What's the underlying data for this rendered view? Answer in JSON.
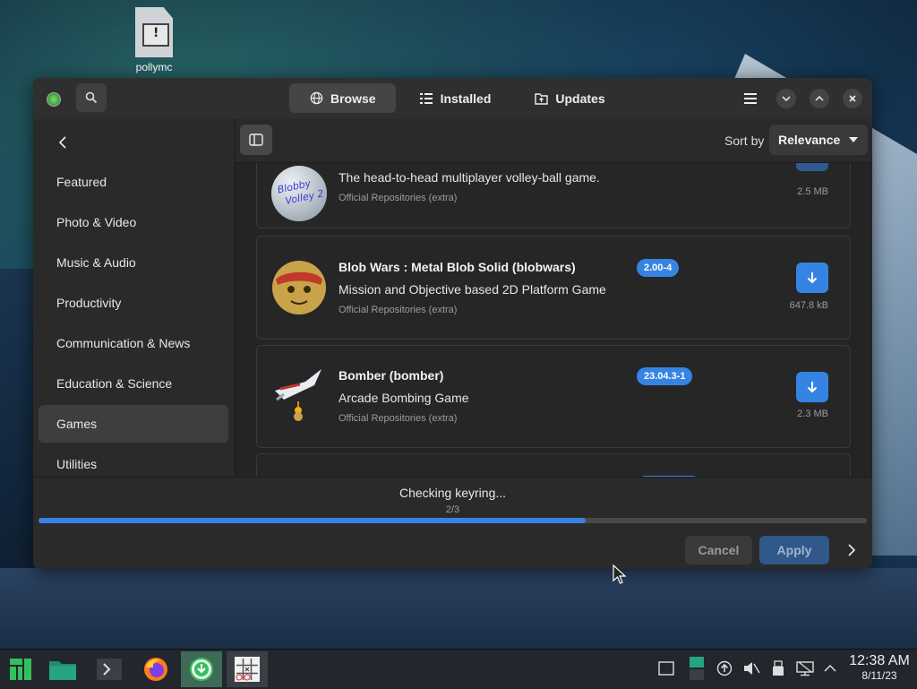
{
  "desktop": {
    "icon_label": "pollymc"
  },
  "header": {
    "tabs": [
      {
        "label": "Browse",
        "icon": "globe-icon",
        "active": true
      },
      {
        "label": "Installed",
        "icon": "list-icon",
        "active": false
      },
      {
        "label": "Updates",
        "icon": "update-folder-icon",
        "active": false
      }
    ]
  },
  "sidebar": {
    "categories": [
      {
        "label": "Featured"
      },
      {
        "label": "Photo & Video"
      },
      {
        "label": "Music & Audio"
      },
      {
        "label": "Productivity"
      },
      {
        "label": "Communication & News"
      },
      {
        "label": "Education & Science"
      },
      {
        "label": "Games",
        "active": true
      },
      {
        "label": "Utilities"
      }
    ]
  },
  "toolbar": {
    "sort_label": "Sort by",
    "sort_value": "Relevance"
  },
  "apps": [
    {
      "name": "",
      "description": "The head-to-head multiplayer volley-ball game.",
      "repo": "Official Repositories (extra)",
      "version": "",
      "size": "2.5 MB",
      "installed": true,
      "icon_text": "Blobby Volley 2"
    },
    {
      "name": "Blob Wars : Metal Blob Solid (blobwars)",
      "description": "Mission and Objective based 2D Platform Game",
      "repo": "Official Repositories (extra)",
      "version": "2.00-4",
      "size": "647.8 kB",
      "installed": false
    },
    {
      "name": "Bomber (bomber)",
      "description": "Arcade Bombing Game",
      "repo": "Official Repositories (extra)",
      "version": "23.04.3-1",
      "size": "2.3 MB",
      "installed": false
    }
  ],
  "progress": {
    "status": "Checking keyring...",
    "step": "2/3",
    "fraction": 0.66
  },
  "footer": {
    "cancel_label": "Cancel",
    "apply_label": "Apply"
  },
  "taskbar": {
    "time": "12:38 AM",
    "date": "8/11/23"
  },
  "colors": {
    "accent": "#3584e4",
    "active_task": "#3e6b55"
  }
}
